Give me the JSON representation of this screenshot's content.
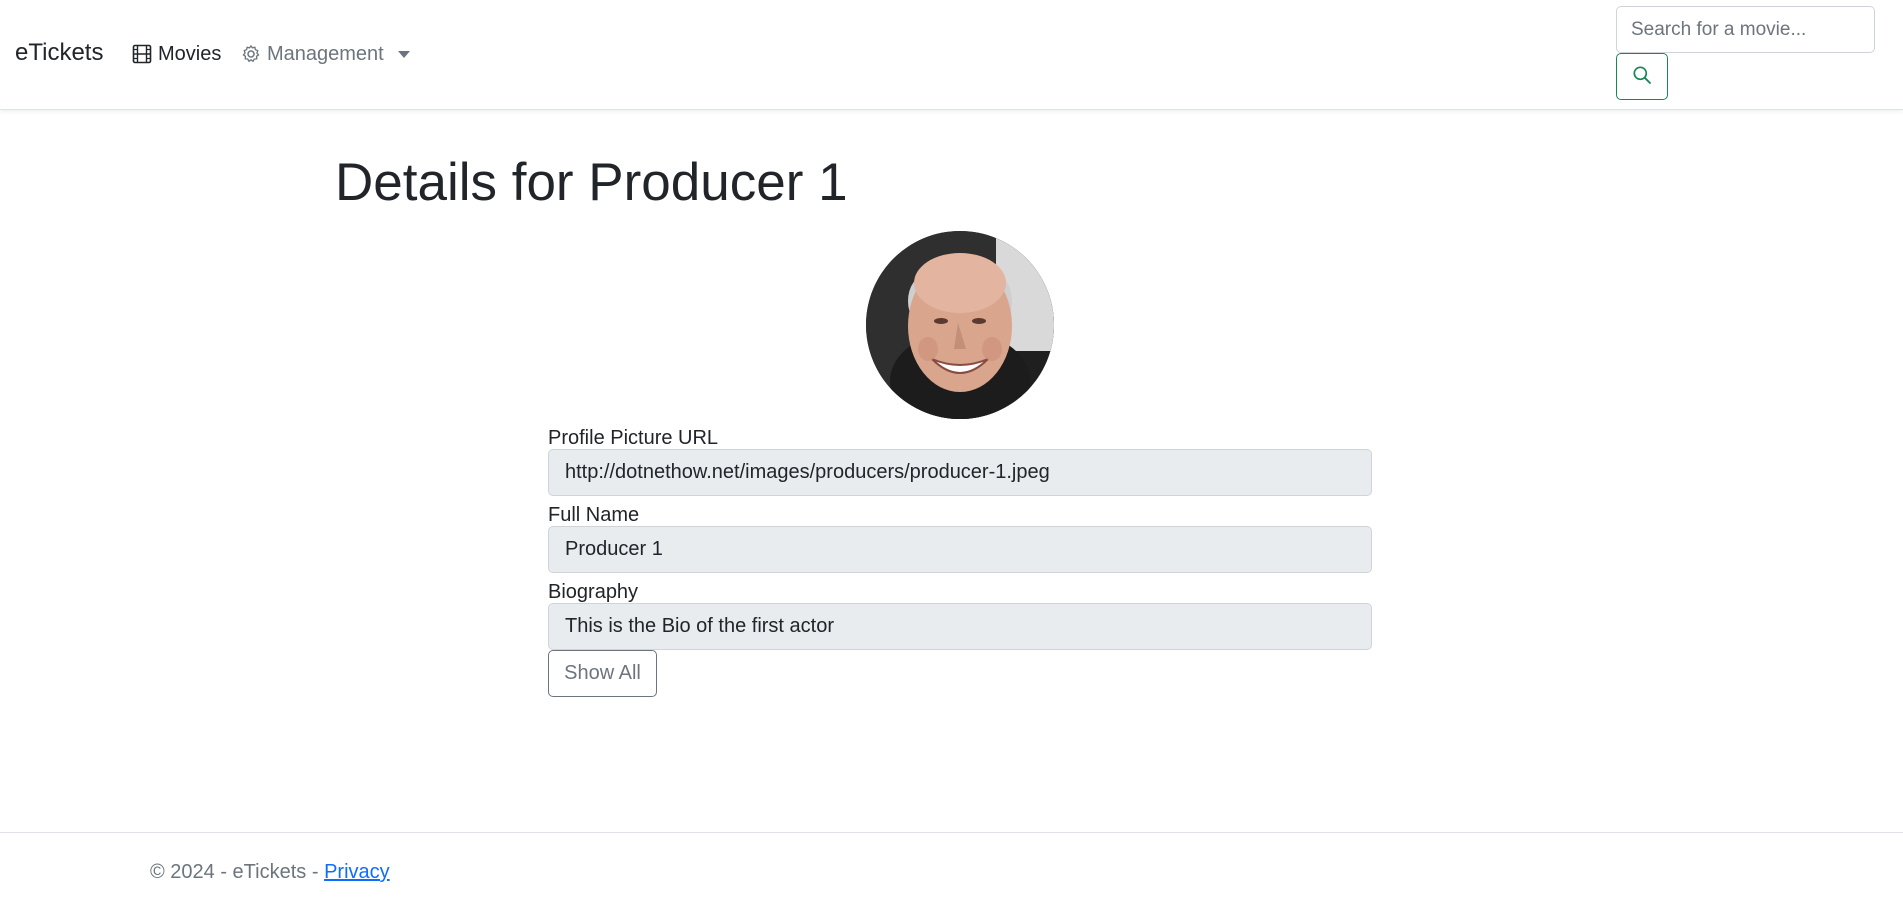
{
  "navbar": {
    "brand": "eTickets",
    "movies_label": "Movies",
    "management_label": "Management",
    "search_placeholder": "Search for a movie..."
  },
  "page": {
    "title": "Details for Producer 1"
  },
  "form": {
    "profile_picture_label": "Profile Picture URL",
    "profile_picture_value": "http://dotnethow.net/images/producers/producer-1.jpeg",
    "full_name_label": "Full Name",
    "full_name_value": "Producer 1",
    "biography_label": "Biography",
    "biography_value": "This is the Bio of the first actor",
    "show_all_label": "Show All"
  },
  "footer": {
    "text": "© 2024 - eTickets - ",
    "privacy_link": "Privacy"
  },
  "icons": {
    "movies": "film-icon",
    "management": "gear-icon",
    "search": "search-icon"
  },
  "colors": {
    "accent": "#198754",
    "muted": "#6c757d",
    "link": "#0d6efd",
    "readonly_bg": "#e9ecef"
  }
}
